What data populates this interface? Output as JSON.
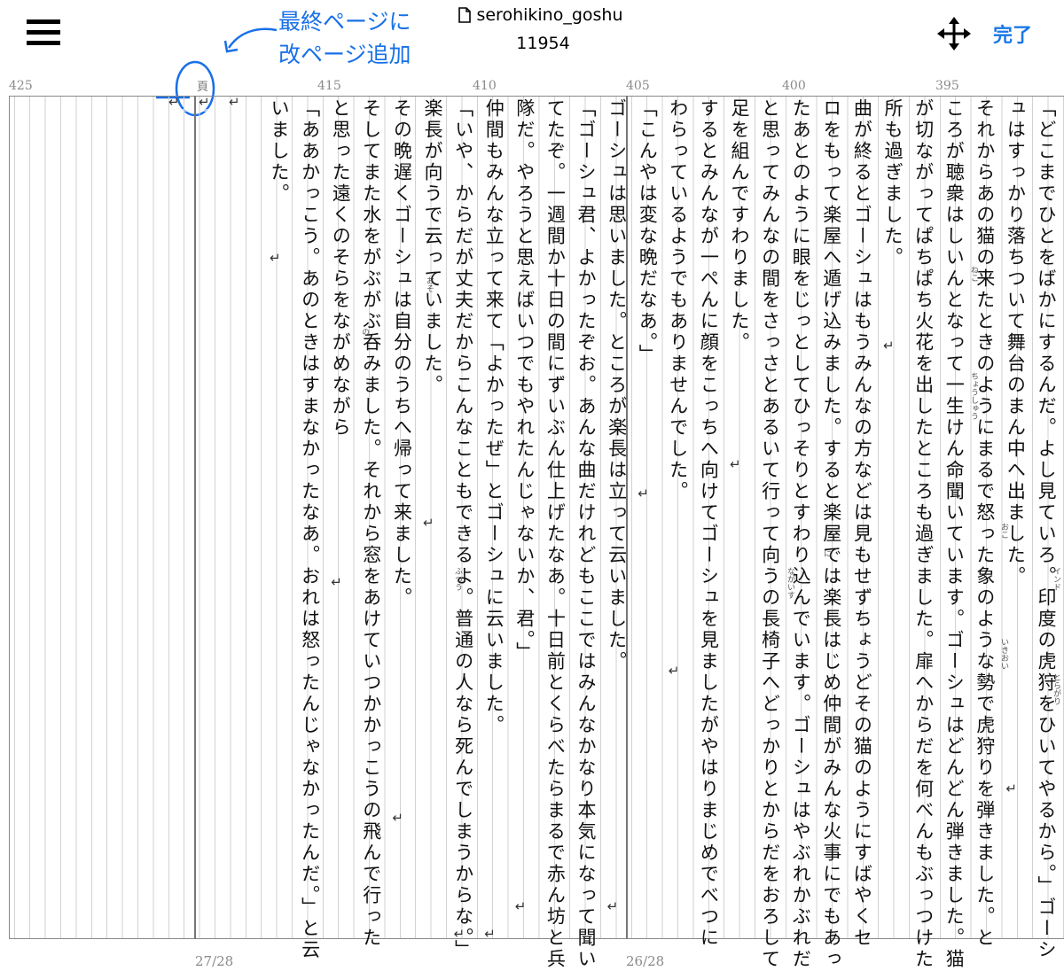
{
  "header": {
    "title": "serohikino_goshu",
    "count": "11954",
    "done_label": "完了",
    "note_line1": "最終ページに",
    "note_line2": "改ページ追加"
  },
  "icons": [
    "menu-icon",
    "document-icon",
    "move-arrows-icon",
    "arrow-icon"
  ],
  "accent_color": "#1b78e6",
  "ruler": [
    "425",
    "415",
    "410",
    "405",
    "400",
    "395"
  ],
  "page_kanji": "頁",
  "return_mark": "↵",
  "pages": {
    "left": "27/28",
    "right": "26/28"
  },
  "columns": [
    "「どこまでひとをばかにするんだ。よし見ていろ。印度の虎狩をひいてやるから。」ゴーシ",
    "ュはすっかり落ちついて舞台のまん中へ出ました。",
    "それからあの猫の来たときのようにまるで怒った象のような勢で虎狩りを弾きました。と",
    "ころが聴衆はしいんとなって一生けん命聞いています。ゴーシュはどんどん弾きました。猫",
    "が切ながってぱちぱち火花を出したところも過ぎました。扉へからだを何べんもぶっつけた",
    "所も過ぎました。",
    "曲が終るとゴーシュはもうみんなの方などは見もせずちょうどその猫のようにすばやくセ",
    "ロをもって楽屋へ遁げ込みました。すると楽屋では楽長はじめ仲間がみんな火事にでもあっ",
    "たあとのように眼をじっとしてひっそりとすわり込んでいます。ゴーシュはやぶれかぶれだ",
    "と思ってみんなの間をさっさとあるいて行って向うの長椅子へどっかりとからだをおろして",
    "足を組んですわりました。",
    "するとみんなが一ぺんに顔をこっちへ向けてゴーシュを見ましたがやはりまじめでべつに",
    "わらっているようでもありませんでした。",
    "「こんやは変な晩だなあ。」",
    "ゴーシュは思いました。ところが楽長は立って云いました。",
    "「ゴーシュ君、よかったぞお。あんな曲だけれどもここではみんなかなり本気になって聞い",
    "てたぞ。一週間か十日の間にずいぶん仕上げたなあ。十日前とくらべたらまるで赤ん坊と兵",
    "隊だ。やろうと思えばいつでもやれたんじゃないか、君。」",
    "仲間もみんな立って来て「よかったぜ」とゴーシュに云いました。",
    "「いや、からだが丈夫だからこんなこともできるよ。普通の人なら死んでしまうからな。」",
    "楽長が向うで云っていました。",
    "その晩遅くゴーシュは自分のうちへ帰って来ました。",
    "そしてまた水をがぶがぶ呑みました。それから窓をあけていつかかっこうの飛んで行った",
    "と思った遠くのそらをながめながら",
    "「ああかっこう。あのときはすまなかったなあ。おれは怒ったんじゃなかったんだ。」と云",
    "いました。"
  ],
  "ruby": [
    "インド",
    "とらがり",
    "いきおい",
    "おこ",
    "ちょうしゅう",
    "ねこ",
    "に",
    "ながいす",
    "ふつう",
    "おそ",
    "の"
  ]
}
